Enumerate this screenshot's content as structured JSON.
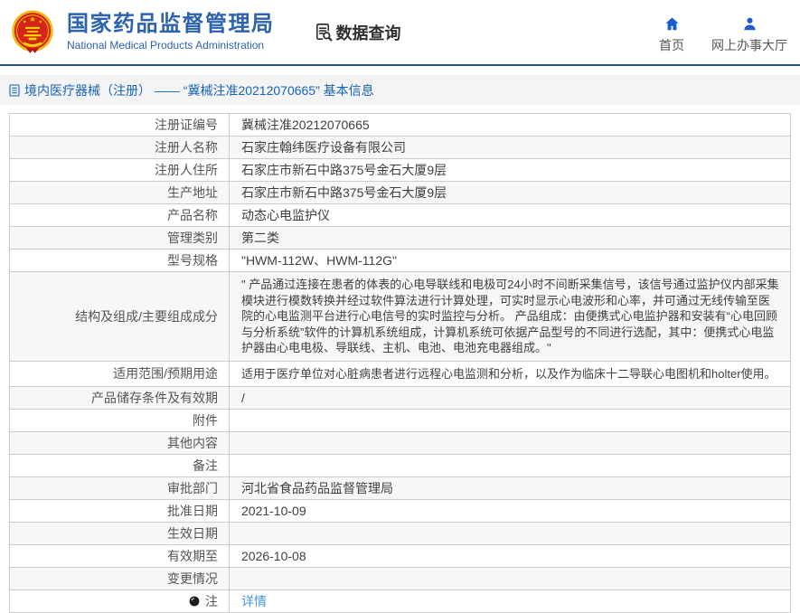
{
  "header": {
    "logo_icon": "national-emblem-icon",
    "org_name_zh": "国家药品监督管理局",
    "org_name_en": "National Medical Products Administration",
    "data_query_label": "数据查询",
    "data_query_icon": "document-search-icon",
    "nav": [
      {
        "label": "首页",
        "icon": "home-icon"
      },
      {
        "label": "网上办事大厅",
        "icon": "user-icon"
      }
    ]
  },
  "breadcrumb": {
    "icon": "page-icon",
    "text": "境内医疗器械（注册） —— “冀械注准20212070665” 基本信息"
  },
  "table": {
    "rows": [
      {
        "label": "注册证编号",
        "value": "冀械注准20212070665"
      },
      {
        "label": "注册人名称",
        "value": "石家庄翰纬医疗设备有限公司"
      },
      {
        "label": "注册人住所",
        "value": "石家庄市新石中路375号金石大厦9层"
      },
      {
        "label": "生产地址",
        "value": "石家庄市新石中路375号金石大厦9层"
      },
      {
        "label": "产品名称",
        "value": "动态心电监护仪"
      },
      {
        "label": "管理类别",
        "value": "第二类"
      },
      {
        "label": "型号规格",
        "value": "\"HWM-112W、HWM-112G\""
      },
      {
        "label": "结构及组成/主要组成成分",
        "value": "\" 产品通过连接在患者的体表的心电导联线和电极可24小时不间断采集信号，该信号通过监护仪内部采集模块进行模数转换并经过软件算法进行计算处理，可实时显示心电波形和心率，并可通过无线传输至医院的心电监测平台进行心电信号的实时监控与分析。 产品组成：由便携式心电监护器和安装有“心电回顾与分析系统”软件的计算机系统组成，计算机系统可依据产品型号的不同进行选配，其中：便携式心电监护器由心电电极、导联线、主机、电池、电池充电器组成。\""
      },
      {
        "label": "适用范围/预期用途",
        "value": "适用于医疗单位对心脏病患者进行远程心电监测和分析，以及作为临床十二导联心电图机和holter使用。"
      },
      {
        "label": "产品储存条件及有效期",
        "value": "/"
      },
      {
        "label": "附件",
        "value": ""
      },
      {
        "label": "其他内容",
        "value": ""
      },
      {
        "label": "备注",
        "value": ""
      },
      {
        "label": "审批部门",
        "value": "河北省食品药品监督管理局"
      },
      {
        "label": "批准日期",
        "value": "2021-10-09"
      },
      {
        "label": "生效日期",
        "value": ""
      },
      {
        "label": "有效期至",
        "value": "2026-10-08"
      },
      {
        "label": "变更情况",
        "value": ""
      },
      {
        "label": "注",
        "value": "详情",
        "link": true,
        "icon": "note-icon"
      }
    ]
  },
  "colors": {
    "title_blue": "#2c62ae",
    "icon_blue": "#1a5ecc",
    "divider_blue": "#24509e",
    "breadcrumb_blue": "#1563b8",
    "link_blue": "#4493e0",
    "stripe_gray": "#f7f7f7",
    "border_gray": "#cccccc",
    "emblem_red": "#d42517",
    "emblem_gold": "#f2c118"
  }
}
